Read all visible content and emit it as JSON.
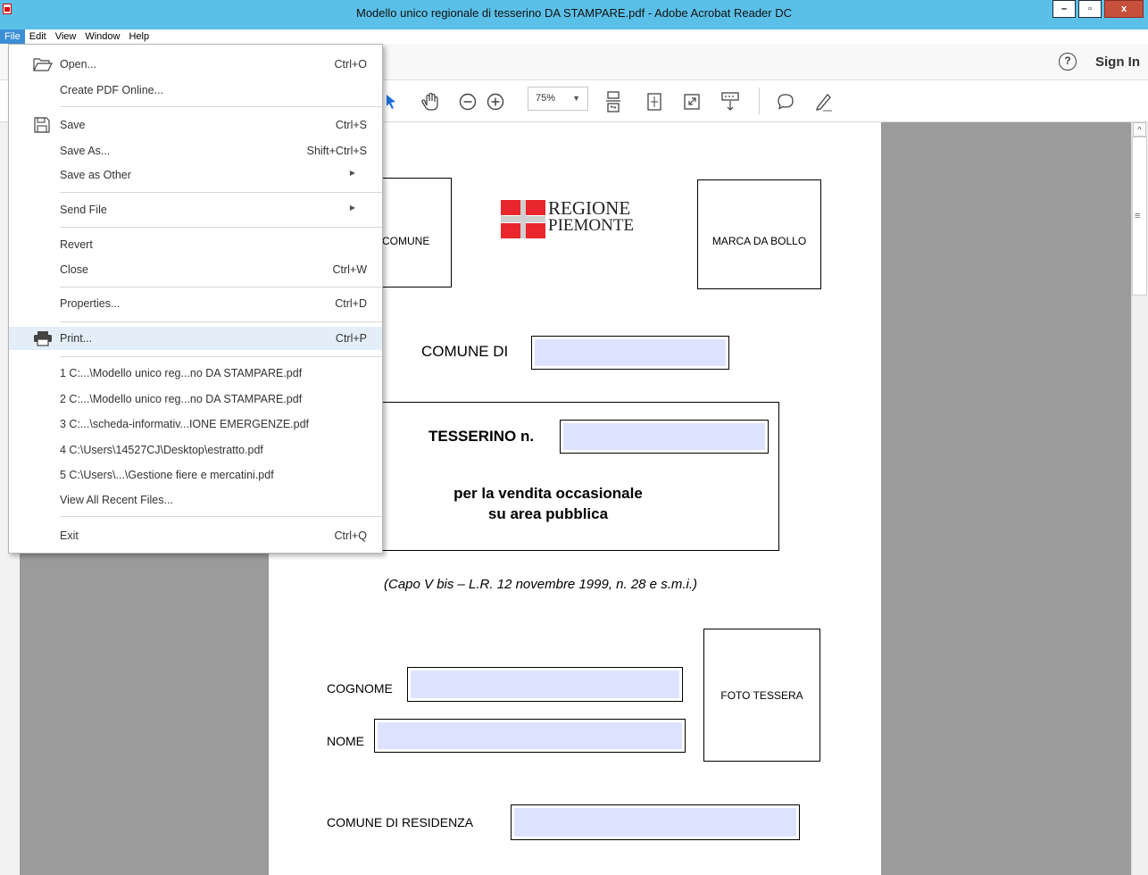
{
  "window": {
    "title": "Modello unico regionale di tesserino DA STAMPARE.pdf - Adobe Acrobat Reader DC",
    "controls": {
      "minimize": "–",
      "maximize": "▫",
      "close": "x"
    }
  },
  "menubar": [
    "File",
    "Edit",
    "View",
    "Window",
    "Help"
  ],
  "top": {
    "signin": "Sign In",
    "help": "?"
  },
  "toolbar": {
    "zoom": "75%"
  },
  "file_menu": {
    "open": {
      "label": "Open...",
      "shortcut": "Ctrl+O"
    },
    "create_pdf": {
      "label": "Create PDF Online..."
    },
    "save": {
      "label": "Save",
      "shortcut": "Ctrl+S"
    },
    "save_as": {
      "label": "Save As...",
      "shortcut": "Shift+Ctrl+S"
    },
    "save_other": {
      "label": "Save as Other"
    },
    "send_file": {
      "label": "Send File"
    },
    "revert": {
      "label": "Revert"
    },
    "close": {
      "label": "Close",
      "shortcut": "Ctrl+W"
    },
    "properties": {
      "label": "Properties...",
      "shortcut": "Ctrl+D"
    },
    "print": {
      "label": "Print...",
      "shortcut": "Ctrl+P"
    },
    "recent": [
      "1 C:...\\Modello unico reg...no DA STAMPARE.pdf",
      "2 C:...\\Modello unico reg...no DA STAMPARE.pdf",
      "3 C:...\\scheda-informativ...IONE EMERGENZE.pdf",
      "4 C:\\Users\\14527CJ\\Desktop\\estratto.pdf",
      "5 C:\\Users\\...\\Gestione fiere e mercatini.pdf"
    ],
    "view_all": {
      "label": "View All Recent Files..."
    },
    "exit": {
      "label": "Exit",
      "shortcut": "Ctrl+Q"
    }
  },
  "document": {
    "comune_box": "COMUNE",
    "logo_line1": "REGIONE",
    "logo_line2": "PIEMONTE",
    "marca_da_bollo": "MARCA DA BOLLO",
    "comune_di": "COMUNE DI",
    "tesserino": "TESSERINO n.",
    "vendita_line1": "per la vendita occasionale",
    "vendita_line2": "su area pubblica",
    "legal": "(Capo V bis – L.R. 12 novembre 1999, n. 28 e s.m.i.)",
    "cognome": "COGNOME",
    "nome": "NOME",
    "foto": "FOTO TESSERA",
    "residenza": "COMUNE DI RESIDENZA"
  },
  "colors": {
    "titlebar": "#5bc0e8",
    "menu_active": "#3c8fd6",
    "form_field": "#dde3ff",
    "close": "#c7503d"
  }
}
